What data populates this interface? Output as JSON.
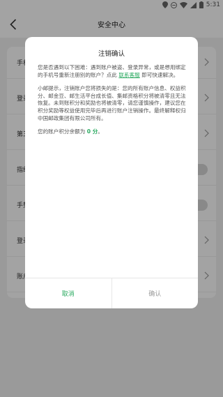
{
  "status_bar": {
    "time": "5:31"
  },
  "header": {
    "title": "安全中心"
  },
  "list": {
    "rows": [
      {
        "label": "手机号",
        "control": "chevron"
      },
      {
        "label": "登录密码",
        "control": "chevron"
      },
      {
        "label": "第三方账号",
        "control": "chevron"
      },
      {
        "label": "指纹登录",
        "control": "toggle"
      },
      {
        "label": "手势密码",
        "control": "toggle"
      },
      {
        "label": "登录设备",
        "control": "chevron"
      },
      {
        "label": "账户注销",
        "control": "chevron"
      }
    ]
  },
  "dialog": {
    "title": "注销确认",
    "para1_pre": "您是否遇到以下困难：遇到账户被盗、登录异常，或是想用绑定的手机号重新注册别的账户？点此",
    "para1_link": "联系客服",
    "para1_post": "即可快速解决。",
    "para2": "小邮提示，注销账户您将损失的是：您的所有账户信息、权益积分、邮金豆、邮生活平台成长值、集邮资格积分将被清零且无法恢复。未到账积分和奖励也将被清零，请您谨慎操作，建议您在积分奖励等权益使用完毕后再进行账户注销操作。最终解释权归中国邮政集团有限公司所有。",
    "points_pre": "您的账户积分余额为",
    "points_value": "0 分",
    "points_post": "。",
    "cancel_label": "取消",
    "confirm_label": "确认"
  },
  "colors": {
    "accent": "#2aaa60",
    "overlay": "rgba(0,0,0,0.36)"
  }
}
